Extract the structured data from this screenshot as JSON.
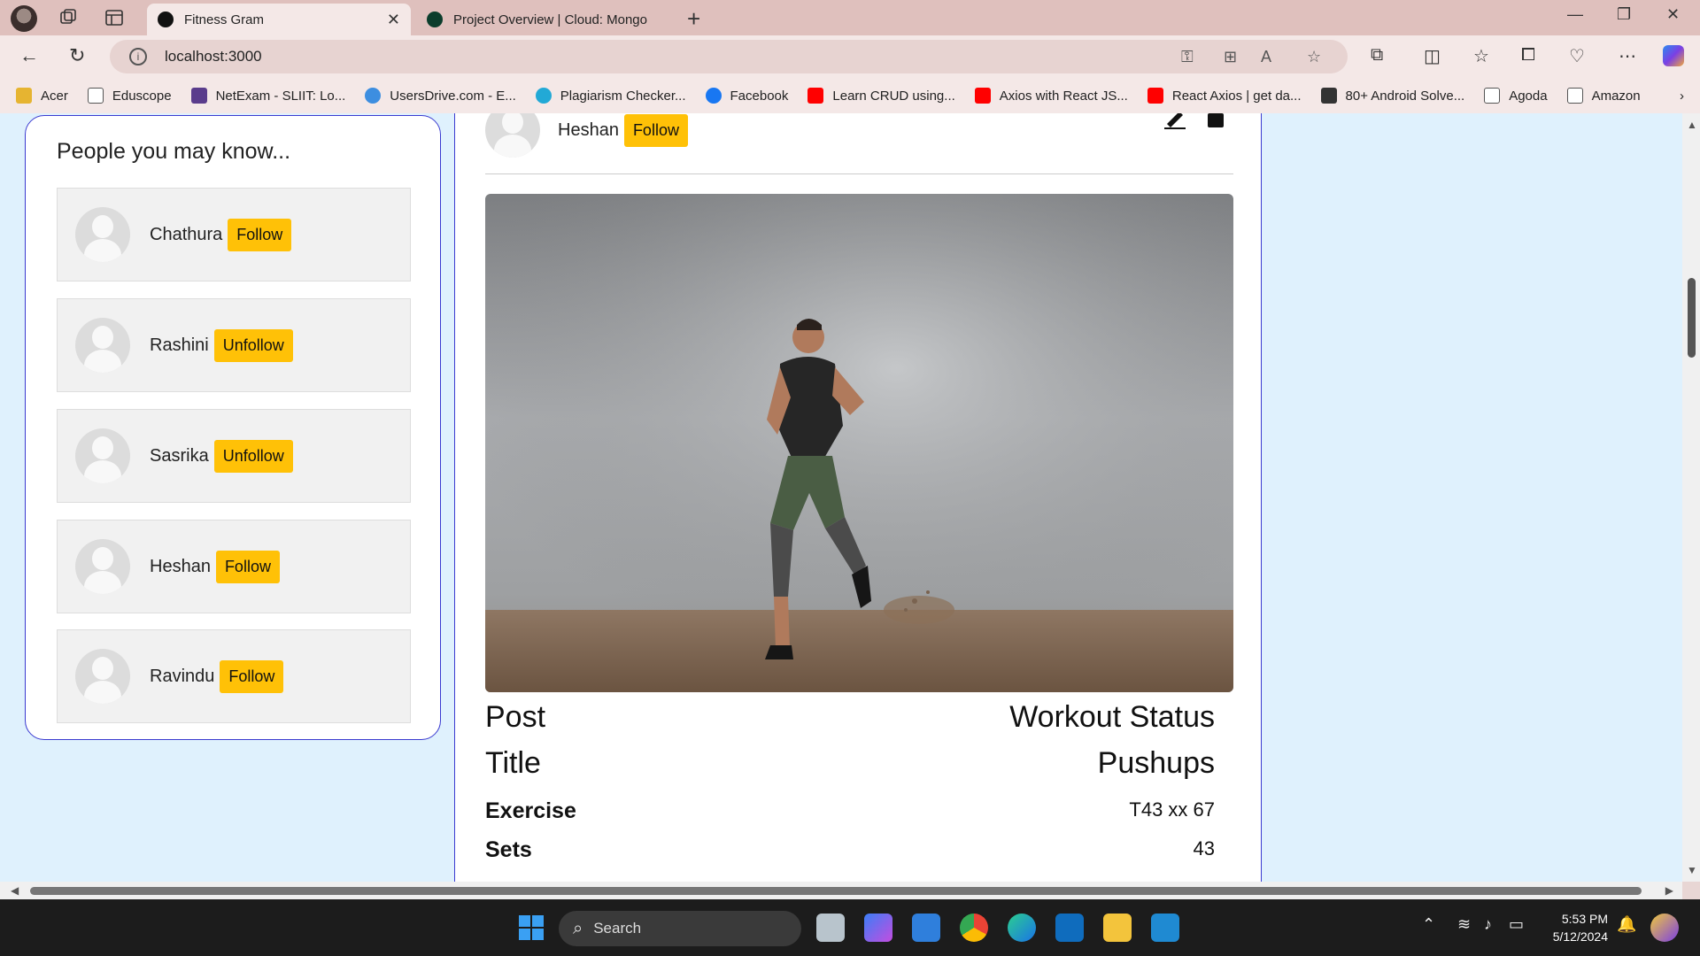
{
  "browser": {
    "tabs": [
      {
        "title": "Fitness Gram",
        "active": true,
        "favicon_color": "#111111"
      },
      {
        "title": "Project Overview | Cloud: Mongo",
        "active": false,
        "favicon_color": "#0b3d2c"
      }
    ],
    "url": "localhost:3000",
    "bookmarks": [
      {
        "label": "Acer",
        "icon": "folder-icon",
        "color": "#e6b431"
      },
      {
        "label": "Eduscope",
        "icon": "page-icon",
        "color": "#555555"
      },
      {
        "label": "NetExam - SLIIT: Lo...",
        "icon": "netexam-icon",
        "color": "#5a3c8c"
      },
      {
        "label": "UsersDrive.com - E...",
        "icon": "usersdrive-icon",
        "color": "#3d8ee0"
      },
      {
        "label": "Plagiarism Checker...",
        "icon": "plagiarism-icon",
        "color": "#22a9d6"
      },
      {
        "label": "Facebook",
        "icon": "facebook-icon",
        "color": "#1877f2"
      },
      {
        "label": "Learn CRUD using...",
        "icon": "youtube-icon",
        "color": "#ff0000"
      },
      {
        "label": "Axios with React JS...",
        "icon": "youtube-icon",
        "color": "#ff0000"
      },
      {
        "label": "React Axios | get da...",
        "icon": "youtube-icon",
        "color": "#ff0000"
      },
      {
        "label": "80+ Android Solve...",
        "icon": "medium-icon",
        "color": "#333333"
      },
      {
        "label": "Agoda",
        "icon": "page-icon",
        "color": "#555555"
      },
      {
        "label": "Amazon",
        "icon": "page-icon",
        "color": "#555555"
      }
    ]
  },
  "sidebar": {
    "title": "People you may know...",
    "people": [
      {
        "name": "Chathura",
        "action": "Follow"
      },
      {
        "name": "Rashini",
        "action": "Unfollow"
      },
      {
        "name": "Sasrika",
        "action": "Unfollow"
      },
      {
        "name": "Heshan",
        "action": "Follow"
      },
      {
        "name": "Ravindu",
        "action": "Follow"
      }
    ]
  },
  "post": {
    "author": "Heshan",
    "follow_label": "Follow",
    "fields": {
      "post_label": "Post",
      "status": "Workout Status",
      "title_label": "Title",
      "title_value": "Pushups",
      "exercise_label": "Exercise",
      "exercise_value": "T43 xx 67",
      "sets_label": "Sets",
      "sets_value": "43"
    }
  },
  "taskbar": {
    "search_placeholder": "Search",
    "time": "5:53 PM",
    "date": "5/12/2024"
  },
  "colors": {
    "accent_button": "#ffc107",
    "card_border": "#3a3ad0",
    "page_bg": "#dff1fd"
  }
}
